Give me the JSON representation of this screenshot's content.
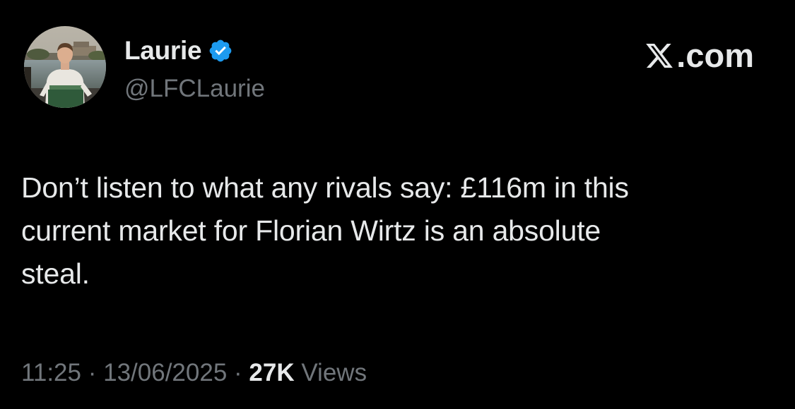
{
  "author": {
    "display_name": "Laurie",
    "handle": "@LFCLaurie",
    "verified": true,
    "verified_color": "#1d9bf0"
  },
  "brand": {
    "icon": "x-logo-icon",
    "suffix": ".com"
  },
  "tweet": {
    "lines": [
      "Don’t listen to what any rivals say: £116m in this",
      "current market for Florian Wirtz is an absolute",
      "steal."
    ]
  },
  "meta": {
    "time": "11:25",
    "separator": " · ",
    "date": "13/06/2025",
    "views_count": "27K",
    "views_label": " Views"
  },
  "colors": {
    "background": "#000000",
    "primary_text": "#e7e9ea",
    "secondary_text": "#71767b"
  }
}
